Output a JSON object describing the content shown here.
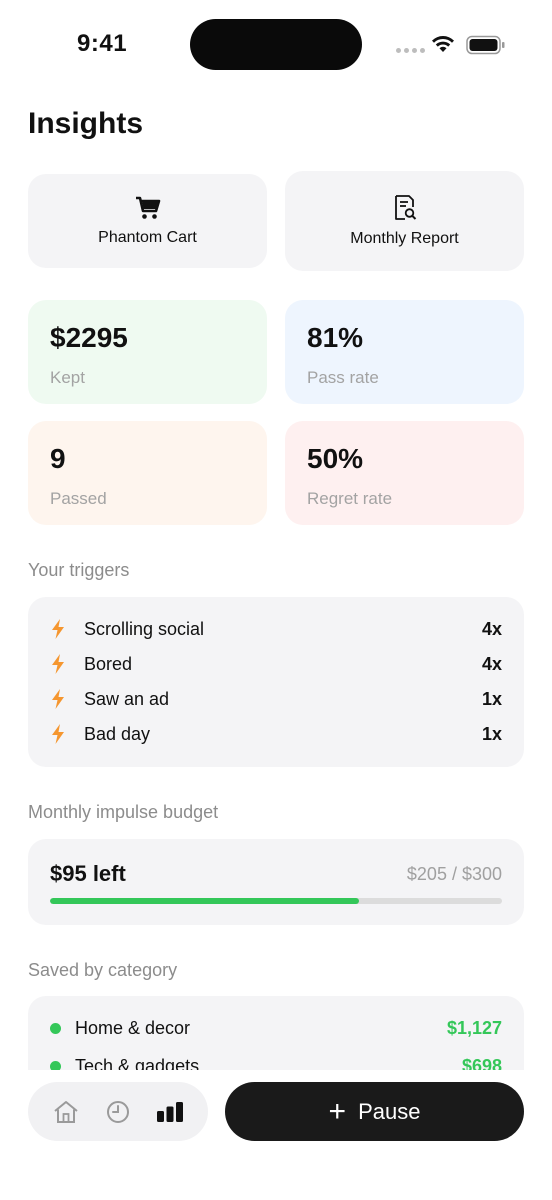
{
  "status_bar": {
    "time": "9:41"
  },
  "page": {
    "title": "Insights"
  },
  "actions": [
    {
      "label": "Phantom Cart",
      "icon": "cart-icon"
    },
    {
      "label": "Monthly Report",
      "icon": "report-icon"
    }
  ],
  "stats": [
    {
      "value": "$2295",
      "label": "Kept",
      "bg": "#effaf1"
    },
    {
      "value": "81%",
      "label": "Pass rate",
      "bg": "#eef5fe"
    },
    {
      "value": "9",
      "label": "Passed",
      "bg": "#fef5ee"
    },
    {
      "value": "50%",
      "label": "Regret rate",
      "bg": "#fef0f0"
    }
  ],
  "triggers": {
    "title": "Your triggers",
    "items": [
      {
        "label": "Scrolling social",
        "count": "4x"
      },
      {
        "label": "Bored",
        "count": "4x"
      },
      {
        "label": "Saw an ad",
        "count": "1x"
      },
      {
        "label": "Bad day",
        "count": "1x"
      }
    ]
  },
  "budget": {
    "title": "Monthly impulse budget",
    "left": "$95 left",
    "ratio": "$205 / $300",
    "progress": 0.683
  },
  "categories": {
    "title": "Saved by category",
    "items": [
      {
        "label": "Home & decor",
        "amount": "$1,127"
      },
      {
        "label": "Tech & gadgets",
        "amount": "$698"
      }
    ]
  },
  "nav": {
    "tabs": [
      "home-icon",
      "history-icon",
      "insights-icon"
    ],
    "pause_label": "Pause"
  },
  "colors": {
    "accent_green": "#34c759",
    "trigger_orange": "#f5962f"
  }
}
